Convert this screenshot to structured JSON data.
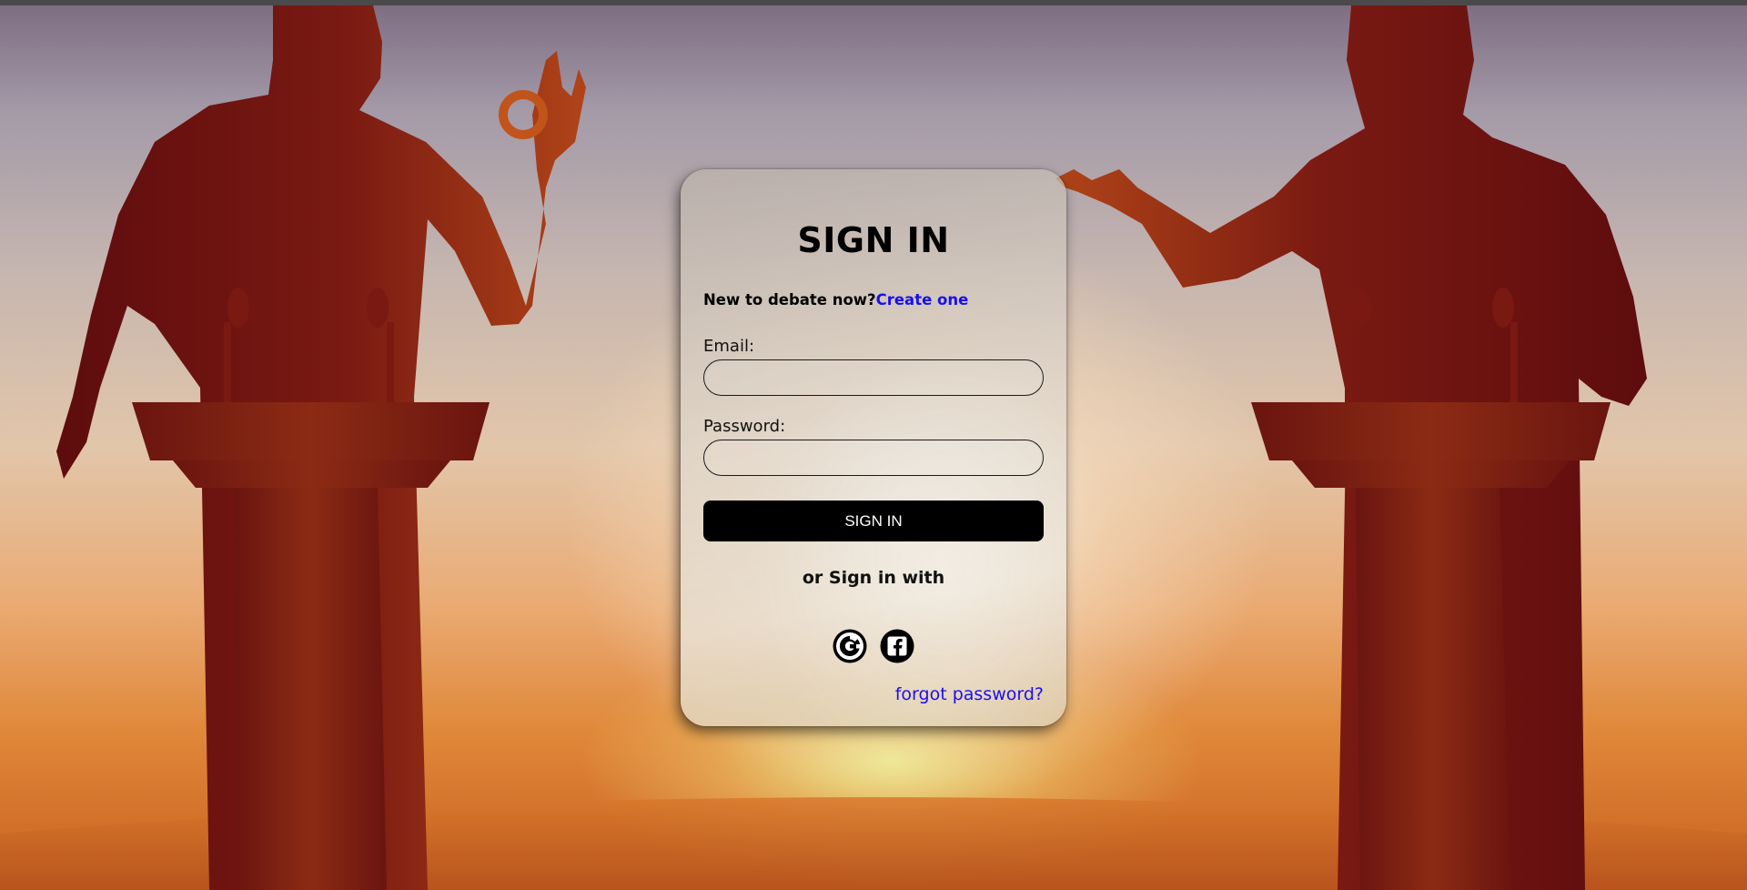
{
  "page": {
    "title": "SIGN IN"
  },
  "signup": {
    "prompt": "New to debate now?",
    "link_label": "Create one"
  },
  "form": {
    "email_label": "Email:",
    "email_value": "",
    "password_label": "Password:",
    "password_value": "",
    "submit_label": "SIGN IN"
  },
  "social": {
    "heading": "or Sign in with",
    "providers": [
      {
        "name": "Google",
        "icon": "google-icon"
      },
      {
        "name": "Facebook",
        "icon": "facebook-icon"
      }
    ]
  },
  "forgot_label": "forgot password?",
  "colors": {
    "link": "#1a0ff0",
    "button_bg": "#000000",
    "button_text": "#ffffff",
    "silhouette": "#6e1414"
  }
}
